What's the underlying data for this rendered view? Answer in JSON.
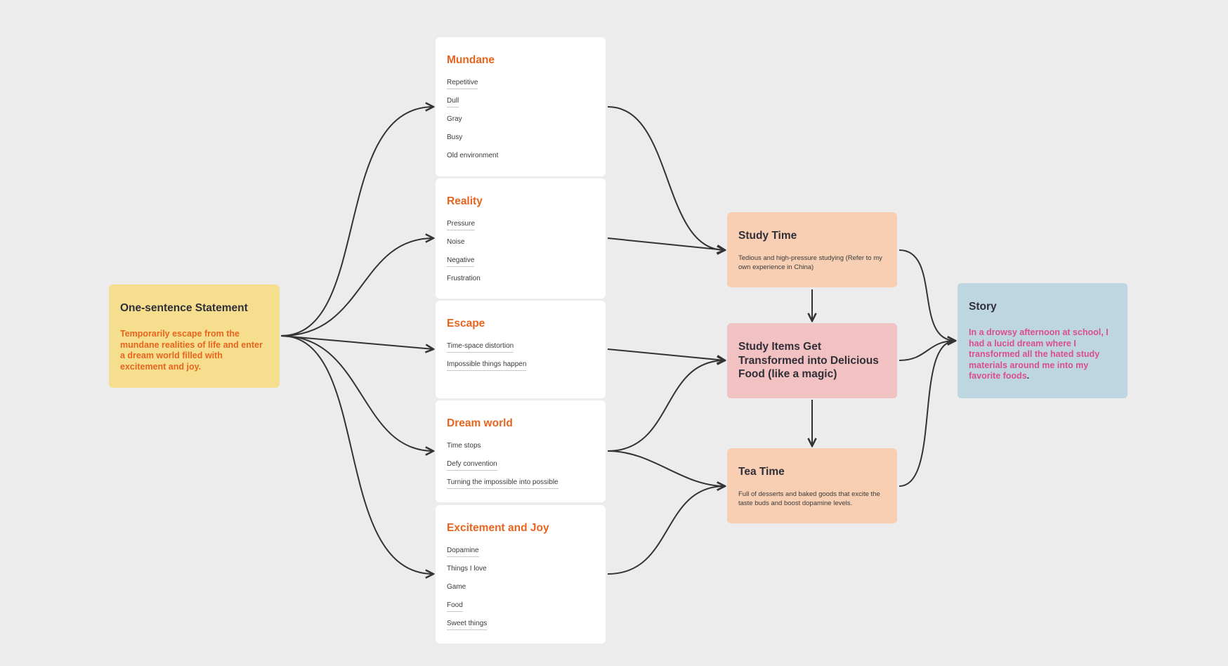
{
  "colors": {
    "background": "#ececec",
    "statement_fill": "#f5df8e",
    "accent_orange": "#e8641e",
    "card_fill": "#ffffff",
    "peach_fill": "#f8cfb3",
    "pink_fill": "#f2c1c1",
    "story_fill": "#bed5e2",
    "story_text": "#d94f8c",
    "edge": "#333333"
  },
  "statement": {
    "title": "One-sentence Statement",
    "body": "Temporarily escape from the mundane realities of life and enter a dream world filled with excitement and joy."
  },
  "categories": [
    {
      "title": "Mundane",
      "items": [
        {
          "label": "Repetitive",
          "underlined": true
        },
        {
          "label": "Dull",
          "underlined": true
        },
        {
          "label": "Gray",
          "underlined": false
        },
        {
          "label": "Busy",
          "underlined": false
        },
        {
          "label": "Old environment",
          "underlined": false
        }
      ]
    },
    {
      "title": "Reality",
      "items": [
        {
          "label": "Pressure",
          "underlined": true
        },
        {
          "label": "Noise",
          "underlined": false
        },
        {
          "label": "Negative",
          "underlined": true
        },
        {
          "label": "Frustration",
          "underlined": false
        }
      ]
    },
    {
      "title": "Escape",
      "items": [
        {
          "label": "Time-space distortion",
          "underlined": true
        },
        {
          "label": "Impossible things happen",
          "underlined": true
        }
      ]
    },
    {
      "title": "Dream world",
      "items": [
        {
          "label": "Time stops",
          "underlined": false
        },
        {
          "label": "Defy convention",
          "underlined": true
        },
        {
          "label": "Turning the impossible into possible",
          "underlined": true
        }
      ]
    },
    {
      "title": "Excitement and Joy",
      "items": [
        {
          "label": "Dopamine",
          "underlined": true
        },
        {
          "label": "Things I love",
          "underlined": false
        },
        {
          "label": "Game",
          "underlined": false
        },
        {
          "label": "Food",
          "underlined": true
        },
        {
          "label": "Sweet things",
          "underlined": true
        }
      ]
    }
  ],
  "flow": [
    {
      "title": "Study Time",
      "body": "Tedious and high-pressure studying (Refer to my own experience in China)"
    },
    {
      "title": "Study Items Get Transformed into Delicious Food (like a magic)",
      "body": ""
    },
    {
      "title": "Tea Time",
      "body": "Full of desserts and baked goods that excite the taste buds and boost dopamine levels."
    }
  ],
  "story": {
    "title": "Story",
    "body": "In a drowsy afternoon at school, I had a lucid dream where I transformed all the hated study materials around me into my favorite foods",
    "period": "."
  },
  "connections": [
    {
      "from": "statement",
      "to": "Mundane"
    },
    {
      "from": "statement",
      "to": "Reality"
    },
    {
      "from": "statement",
      "to": "Escape"
    },
    {
      "from": "statement",
      "to": "Dream world"
    },
    {
      "from": "statement",
      "to": "Excitement and Joy"
    },
    {
      "from": "Mundane",
      "to": "Study Time"
    },
    {
      "from": "Reality",
      "to": "Study Time"
    },
    {
      "from": "Escape",
      "to": "Study Items Get Transformed"
    },
    {
      "from": "Dream world",
      "to": "Study Items Get Transformed"
    },
    {
      "from": "Dream world",
      "to": "Tea Time"
    },
    {
      "from": "Excitement and Joy",
      "to": "Tea Time"
    },
    {
      "from": "Study Time",
      "to": "Study Items Get Transformed"
    },
    {
      "from": "Study Items Get Transformed",
      "to": "Tea Time"
    },
    {
      "from": "Study Time",
      "to": "Story"
    },
    {
      "from": "Study Items Get Transformed",
      "to": "Story"
    },
    {
      "from": "Tea Time",
      "to": "Story"
    }
  ]
}
